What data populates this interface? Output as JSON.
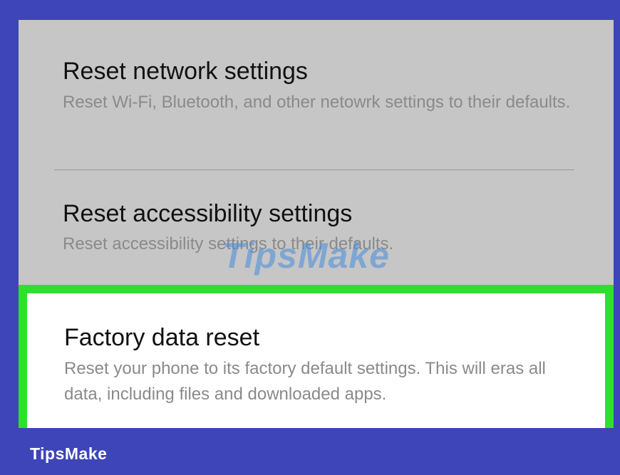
{
  "settings": {
    "items": [
      {
        "title": "Reset network settings",
        "description": "Reset Wi-Fi, Bluetooth, and other netowrk settings to their defaults."
      },
      {
        "title": "Reset accessibility settings",
        "description": "Reset accessibility settings to their defaults."
      },
      {
        "title": "Factory data reset",
        "description": "Reset your phone to its factory default settings. This will eras all data, including files and downloaded apps."
      }
    ]
  },
  "watermark": "TipsMake",
  "footer": {
    "brand": "TipsMake"
  },
  "colors": {
    "frame": "#3d45b8",
    "screen_bg": "#c6c6c6",
    "highlight_border": "#2ee02e",
    "highlight_bg": "#ffffff"
  }
}
